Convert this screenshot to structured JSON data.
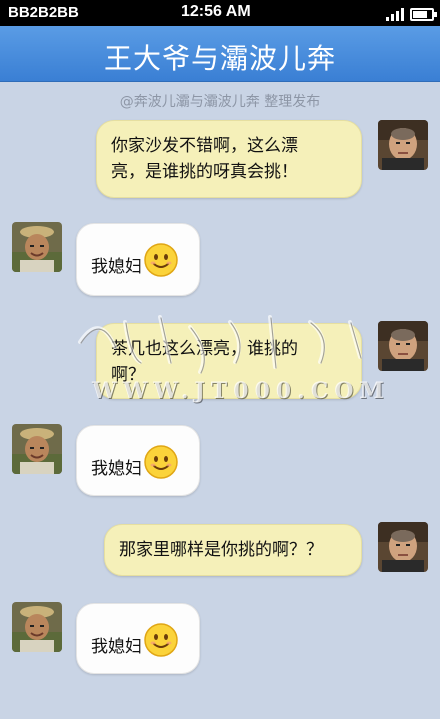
{
  "status_bar": {
    "carrier": "BB2B2BB",
    "time": "12:56 AM"
  },
  "header": {
    "title": "王大爷与灞波儿奔"
  },
  "credit": "@奔波儿灞与灞波儿奔 整理发布",
  "messages": [
    {
      "side": "right",
      "line1": "你家沙发不错啊，这么漂",
      "line2": "亮，是谁挑的呀真会挑！"
    },
    {
      "side": "left",
      "text": "我媳妇",
      "emoji": "smiling-face-icon"
    },
    {
      "side": "right",
      "line1": "茶几也这么漂亮，谁挑的",
      "line2": "啊？"
    },
    {
      "side": "left",
      "text": "我媳妇",
      "emoji": "smiling-face-icon"
    },
    {
      "side": "right",
      "text": "那家里哪样是你挑的啊？？"
    },
    {
      "side": "left",
      "text": "我媳妇",
      "emoji": "smiling-face-icon"
    }
  ],
  "watermark": {
    "text": "WWW.JT000.COM"
  },
  "colors": {
    "header": "#4a8fe0",
    "background": "#c9d4e5",
    "bubble_right": "#f5f0b9",
    "bubble_left": "#fdfdfd"
  }
}
